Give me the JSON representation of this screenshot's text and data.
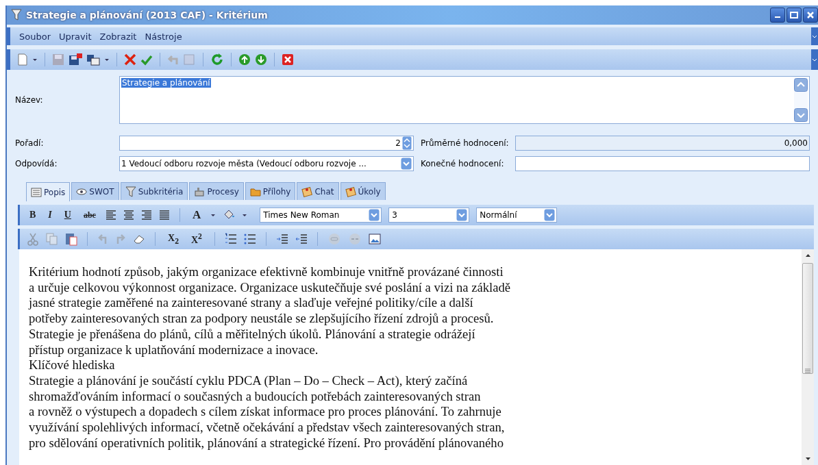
{
  "window": {
    "title": "Strategie a plánování  (2013 CAF) - Kritérium"
  },
  "menu": [
    "Soubor",
    "Upravit",
    "Zobrazit",
    "Nástroje"
  ],
  "form": {
    "name": {
      "label": "Název:",
      "value": "Strategie a plánování"
    },
    "order": {
      "label": "Pořadí:",
      "value": "2"
    },
    "responsible": {
      "label": "Odpovídá:",
      "value": "1 Vedoucí odboru rozvoje města (Vedoucí odboru rozvoje ..."
    },
    "average": {
      "label": "Průměrné hodnocení:",
      "value": "0,000"
    },
    "final": {
      "label": "Konečné hodnocení:"
    }
  },
  "tabs": [
    {
      "label": "Popis",
      "selected": true
    },
    {
      "label": "SWOT",
      "selected": false
    },
    {
      "label": "Subkritéria",
      "selected": false
    },
    {
      "label": "Procesy",
      "selected": false
    },
    {
      "label": "Přílohy",
      "selected": false
    },
    {
      "label": "Chat",
      "selected": false
    },
    {
      "label": "Úkoly",
      "selected": false
    }
  ],
  "editor": {
    "text_buttons": [
      "B",
      "I",
      "U",
      "abc"
    ],
    "color_button": "A",
    "font": "Times New Roman",
    "size": "3",
    "style": "Normální",
    "subscript": "X$_{2}$",
    "superscript": "X$^{2}$",
    "paragraphs": [
      {
        "lines": [
          "Kritérium hodnotí způsob, jakým organizace efektivně kombinuje vnitřně provázané činnosti",
          "a určuje celkovou výkonnost organizace. Organizace uskutečňuje své poslání a vizi na základě",
          "jasné strategie zaměřené na zainteresované strany a slaďuje veřejné politiky/cíle a další",
          "potřeby zainteresovaných stran za podpory neustále se zlepšujícího řízení zdrojů a procesů.",
          "Strategie je přenášena do plánů, cílů a měřitelných úkolů. Plánování a strategie odrážejí",
          "přístup organizace k uplatňování modernizace a inovace."
        ]
      },
      {
        "lines": [
          "Klíčové hlediska"
        ]
      },
      {
        "lines": [
          "Strategie a plánování je součástí cyklu PDCA (Plan – Do – Check – Act), který začíná",
          "shromažďováním informací o současných a budoucích potřebách zainteresovaných stran",
          "a rovněž o výstupech a dopadech s cílem získat informace pro proces plánování. To zahrnuje",
          "využívání spolehlivých informací, včetně očekávání a představ všech zainteresovaných stran,",
          "pro sdělování operativních politik, plánování a strategické řízení. Pro provádění plánovaného"
        ]
      }
    ]
  }
}
